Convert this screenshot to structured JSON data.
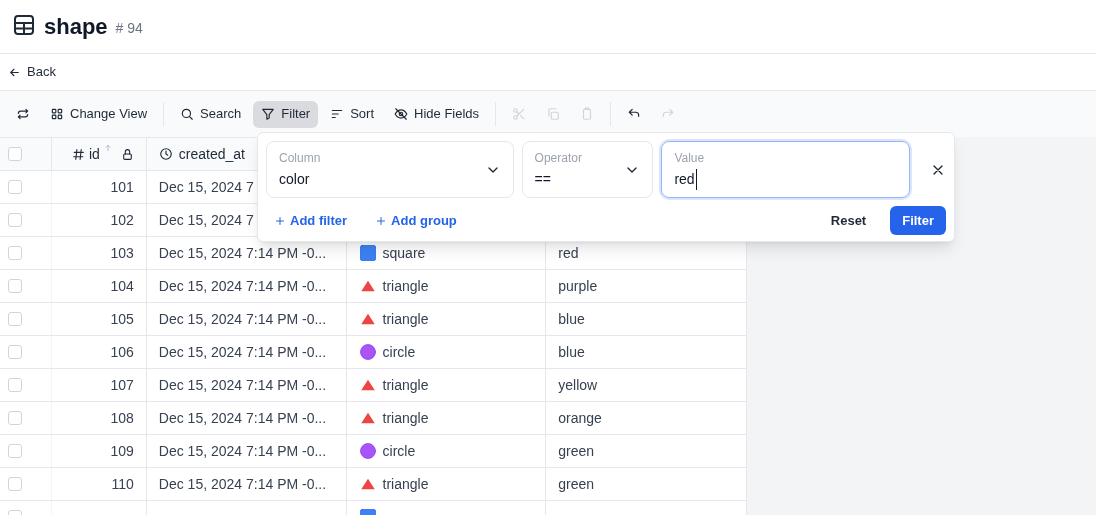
{
  "header": {
    "title": "shape",
    "count": "# 94"
  },
  "back": "Back",
  "toolbar": [
    {
      "kind": "refresh",
      "selected": false,
      "disabled": false
    },
    {
      "kind": "view",
      "label": "Change View",
      "selected": false,
      "disabled": false
    },
    {
      "kind": "search",
      "label": "Search",
      "selected": false,
      "disabled": false
    },
    {
      "kind": "filter",
      "label": "Filter",
      "selected": true,
      "disabled": false
    },
    {
      "kind": "sort",
      "label": "Sort",
      "selected": false,
      "disabled": false
    },
    {
      "kind": "hide",
      "label": "Hide Fields",
      "selected": false,
      "disabled": false
    },
    {
      "kind": "cut",
      "selected": false,
      "disabled": true
    },
    {
      "kind": "copy",
      "selected": false,
      "disabled": true
    },
    {
      "kind": "paste",
      "selected": false,
      "disabled": true
    },
    {
      "kind": "undo",
      "selected": false,
      "disabled": false
    },
    {
      "kind": "redo",
      "selected": false,
      "disabled": true
    }
  ],
  "table": {
    "select_all_checked": false,
    "columns": [
      {
        "label": "id"
      },
      {
        "label": "created_at"
      }
    ],
    "rows": [
      {
        "id": "101",
        "created_at": "Dec 15, 2024 7",
        "checked": false
      },
      {
        "id": "102",
        "created_at": "Dec 15, 2024 7",
        "checked": false
      },
      {
        "id": "103",
        "created_at": "Dec 15, 2024 7:14 PM -0...",
        "kind": "square",
        "shape_name": "square",
        "color_name": "red",
        "checked": false
      },
      {
        "id": "104",
        "created_at": "Dec 15, 2024 7:14 PM -0...",
        "kind": "triangle",
        "shape_name": "triangle",
        "color_name": "purple",
        "checked": false
      },
      {
        "id": "105",
        "created_at": "Dec 15, 2024 7:14 PM -0...",
        "kind": "triangle",
        "shape_name": "triangle",
        "color_name": "blue",
        "checked": false
      },
      {
        "id": "106",
        "created_at": "Dec 15, 2024 7:14 PM -0...",
        "kind": "circle",
        "shape_name": "circle",
        "color_name": "blue",
        "checked": false
      },
      {
        "id": "107",
        "created_at": "Dec 15, 2024 7:14 PM -0...",
        "kind": "triangle",
        "shape_name": "triangle",
        "color_name": "yellow",
        "checked": false
      },
      {
        "id": "108",
        "created_at": "Dec 15, 2024 7:14 PM -0...",
        "kind": "triangle",
        "shape_name": "triangle",
        "color_name": "orange",
        "checked": false
      },
      {
        "id": "109",
        "created_at": "Dec 15, 2024 7:14 PM -0...",
        "kind": "circle",
        "shape_name": "circle",
        "color_name": "green",
        "checked": false
      },
      {
        "id": "110",
        "created_at": "Dec 15, 2024 7:14 PM -0...",
        "kind": "triangle",
        "shape_name": "triangle",
        "color_name": "green",
        "checked": false
      },
      {
        "kind": "square",
        "checked": false
      }
    ]
  },
  "filter_popup": {
    "column": {
      "label": "Column",
      "value": "color"
    },
    "operator": {
      "label": "Operator",
      "value": "=="
    },
    "value": {
      "label": "Value",
      "value": "red"
    },
    "add_filter": "Add filter",
    "add_group": "Add group",
    "reset": "Reset",
    "apply": "Filter"
  }
}
